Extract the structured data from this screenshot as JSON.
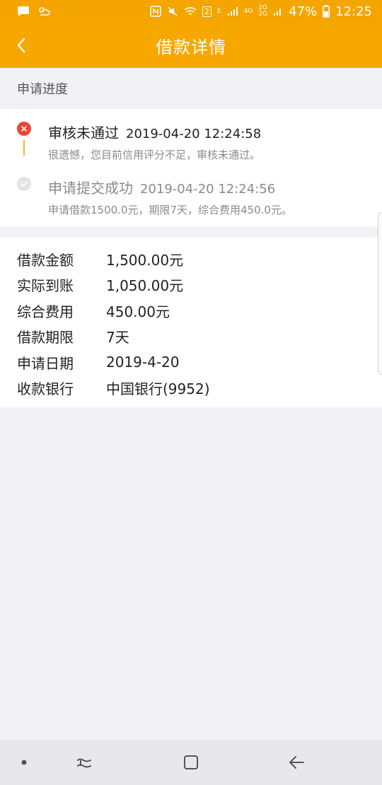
{
  "status_bar": {
    "wifi_badge": "2",
    "network_e": "E",
    "network_4g": "4G",
    "network_2g_top": "2G",
    "network_2g_bottom": "2G",
    "battery": "47%",
    "time": "12:25"
  },
  "header": {
    "title": "借款详情"
  },
  "progress": {
    "section_title": "申请进度",
    "steps": [
      {
        "name": "审核未通过",
        "time": "2019-04-20 12:24:58",
        "desc": "很遗憾，您目前信用评分不足，审核未通过。",
        "status": "failed"
      },
      {
        "name": "申请提交成功",
        "time": "2019-04-20 12:24:56",
        "desc": "申请借款1500.0元，期限7天，综合费用450.0元。",
        "status": "done"
      }
    ]
  },
  "details": {
    "rows": [
      {
        "label": "借款金额",
        "value": "1,500.00元"
      },
      {
        "label": "实际到账",
        "value": "1,050.00元"
      },
      {
        "label": "综合费用",
        "value": "450.00元"
      },
      {
        "label": "借款期限",
        "value": "7天"
      },
      {
        "label": "申请日期",
        "value": "2019-4-20"
      },
      {
        "label": "收款银行",
        "value": "中国银行(9952)"
      }
    ]
  },
  "colors": {
    "accent": "#f7a800",
    "fail": "#ee4433",
    "muted": "#8a8a8a"
  },
  "icons": {
    "back": "chevron-left-icon",
    "fail": "close-circle-icon",
    "ok": "check-circle-icon",
    "nav_dot": "dot-icon",
    "nav_recent": "recent-apps-icon",
    "nav_home": "home-icon",
    "nav_back": "back-arrow-icon"
  }
}
